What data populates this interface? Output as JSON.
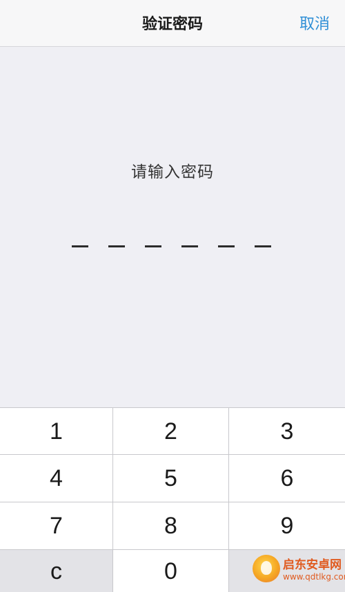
{
  "navbar": {
    "title": "验证密码",
    "cancel_label": "取消"
  },
  "prompt": {
    "text": "请输入密码"
  },
  "passcode": {
    "length": 6,
    "entered": 0
  },
  "keypad": {
    "keys": [
      "1",
      "2",
      "3",
      "4",
      "5",
      "6",
      "7",
      "8",
      "9",
      "c",
      "0",
      ""
    ]
  },
  "watermark": {
    "name": "启东安卓网",
    "url": "www.qdtlkg.com"
  },
  "colors": {
    "accent": "#2f8fd6",
    "background": "#efeff4",
    "key_background": "#ffffff",
    "key_dim_background": "#e3e3e7",
    "separator": "#c8c8cc"
  }
}
